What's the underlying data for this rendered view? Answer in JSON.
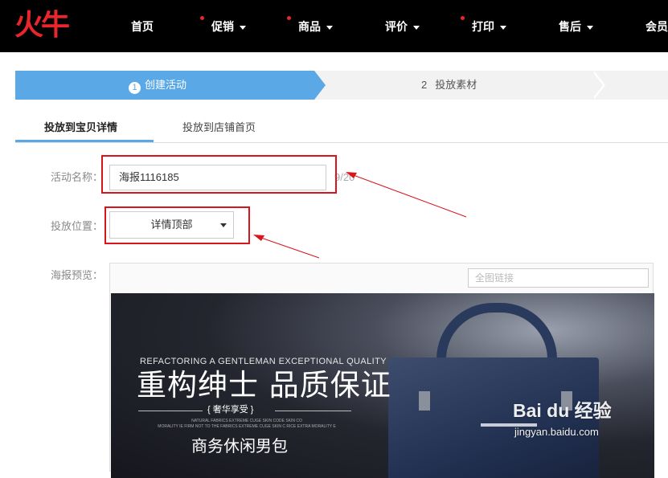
{
  "brand": {
    "logo_text": "火牛",
    "accent_color": "#e8262b"
  },
  "nav": {
    "items": [
      {
        "label": "首页",
        "dot": false,
        "caret": false
      },
      {
        "label": "促销",
        "dot": true,
        "caret": true
      },
      {
        "label": "商品",
        "dot": true,
        "caret": true
      },
      {
        "label": "评价",
        "dot": false,
        "caret": true
      },
      {
        "label": "打印",
        "dot": true,
        "caret": true
      },
      {
        "label": "售后",
        "dot": false,
        "caret": true
      },
      {
        "label": "会员",
        "dot": false,
        "caret": false
      }
    ]
  },
  "steps": {
    "step1": {
      "num": "1",
      "label": "创建活动",
      "active": true
    },
    "step2": {
      "num": "2",
      "label": "投放素材",
      "active": false
    },
    "active_color": "#5aa8e6"
  },
  "tabs": [
    {
      "label": "投放到宝贝详情",
      "active": true
    },
    {
      "label": "投放到店铺首页",
      "active": false
    }
  ],
  "form": {
    "name_label": "活动名称：",
    "name_value": "海报1116185",
    "name_counter": "9/20",
    "position_label": "投放位置：",
    "position_value": "详情顶部",
    "preview_label": "海报预览：",
    "link_placeholder": "全图链接"
  },
  "poster": {
    "en_text": "REFACTORING A GENTLEMAN EXCEPTIONAL QUALITY",
    "title": "重构绅士 品质保证",
    "subtitle": "{ 奢华享受 }",
    "fine_print_1": "NATURAL FABRICS EXTREME CUGE SKIN CODE SKIN CO",
    "fine_print_2": "MORALITY IE FIRM NOT TO THE FABRICS EXTREME CUGE SKIN C RICE EXTRA MORALITY E",
    "cn_caption": "商务休闲男包"
  },
  "watermark": {
    "main": "Bai du 经验",
    "sub": "jingyan.baidu.com",
    "paw": "🐾"
  },
  "annotation_color": "#d9141b"
}
